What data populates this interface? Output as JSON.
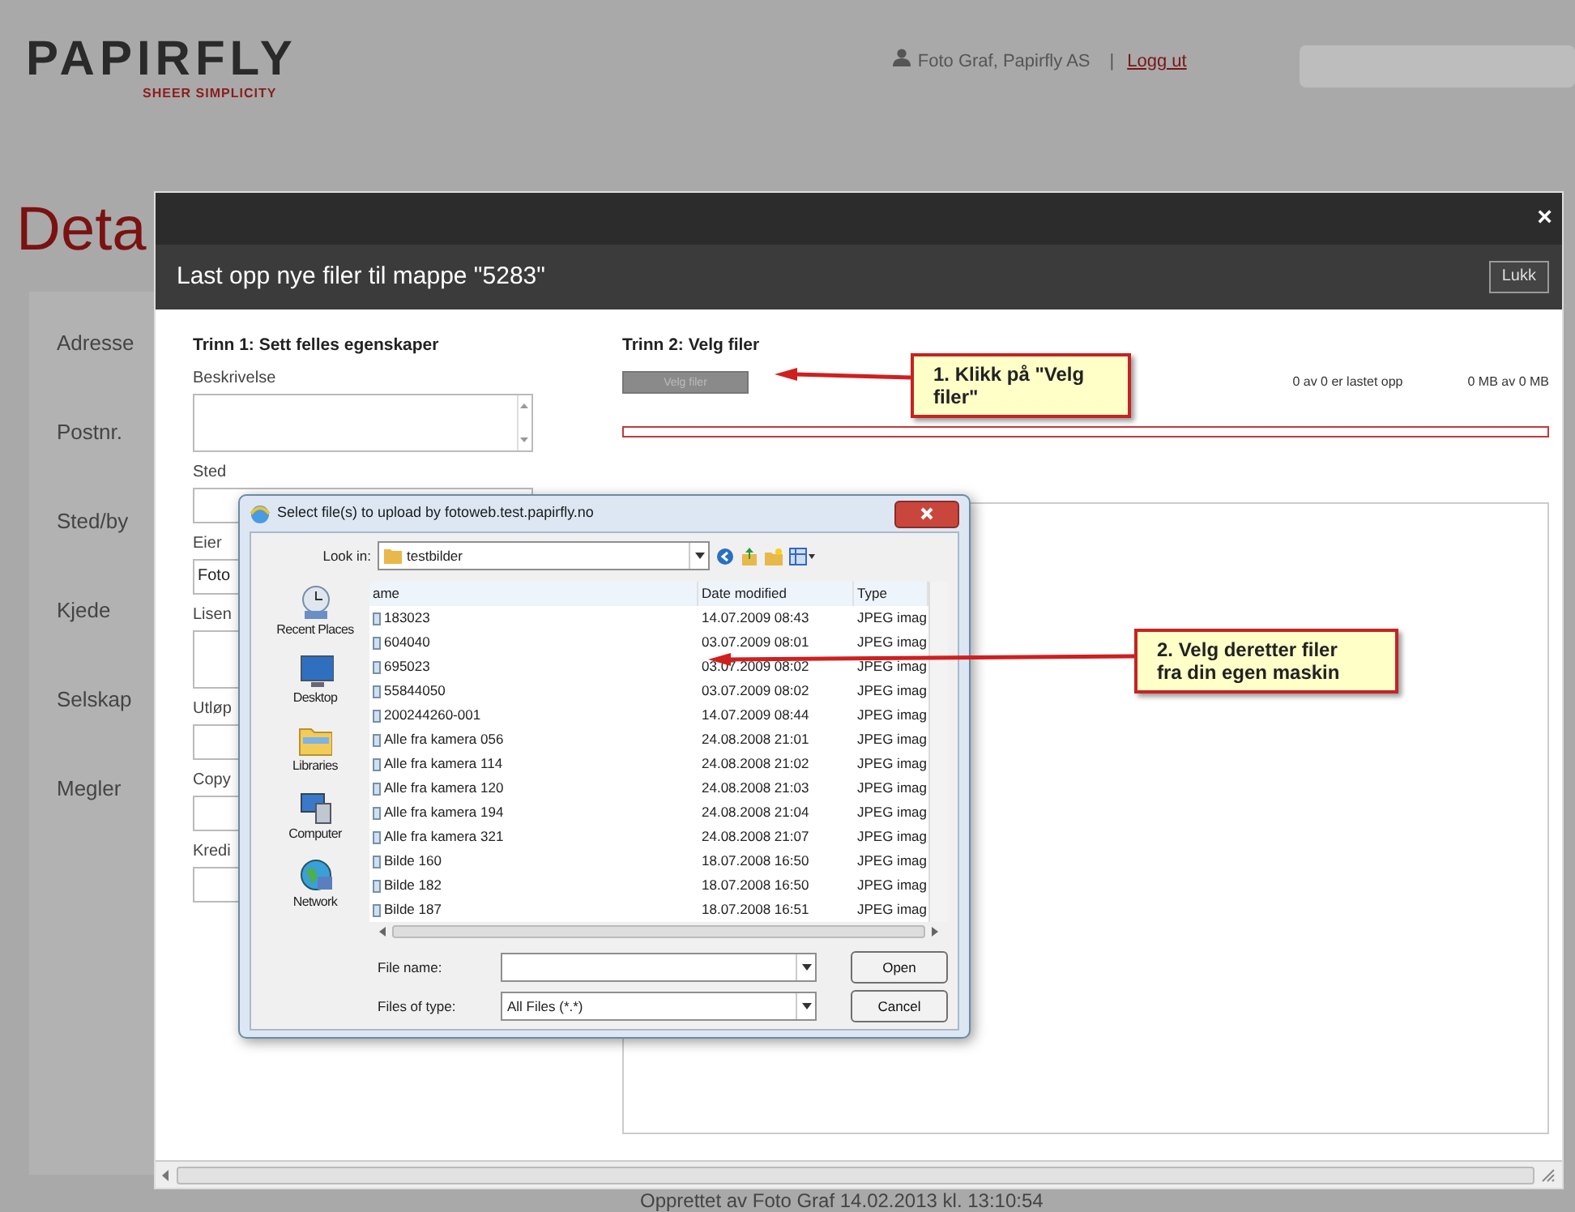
{
  "header": {
    "logo": "PAPIRFLY",
    "tagline": "SHEER SIMPLICITY",
    "user": "Foto Graf, Papirfly AS",
    "separator": "|",
    "logout": "Logg ut"
  },
  "page_title": "Deta",
  "form_labels": [
    "Adresse",
    "Postnr.",
    "Sted/by",
    "Kjede",
    "Selskap",
    "Megler"
  ],
  "modal": {
    "close": "×",
    "title": "Last opp nye filer til mappe \"5283\"",
    "close_button": "Lukk",
    "step1": {
      "heading": "Trinn 1: Sett felles egenskaper",
      "fields": [
        {
          "label": "Beskrivelse",
          "kind": "textarea"
        },
        {
          "label": "Sted",
          "kind": "input"
        },
        {
          "label": "Eier",
          "kind": "input",
          "value": "Foto"
        },
        {
          "label": "Lisen",
          "kind": "textarea"
        },
        {
          "label": "Utløp",
          "kind": "input"
        },
        {
          "label": "Copy",
          "kind": "input"
        },
        {
          "label": "Kredi",
          "kind": "input"
        }
      ]
    },
    "step2": {
      "heading": "Trinn 2: Velg filer",
      "select_button": {
        "label": "Velg filer",
        "disabled": true
      },
      "files_status": "0 av 0 er lastet opp",
      "size_status": "0 MB av 0 MB",
      "progress": {
        "level": 0
      }
    }
  },
  "callouts": [
    {
      "text": "1. Klikk på \"Velg filer\""
    },
    {
      "text": "2. Velg deretter filer fra din egen maskin"
    }
  ],
  "file_dialog": {
    "title": "Select file(s) to upload by fotoweb.test.papirfly.no",
    "look_in_label": "Look in:",
    "look_in": "testbilder",
    "places": [
      "Recent Places",
      "Desktop",
      "Libraries",
      "Computer",
      "Network"
    ],
    "columns": [
      "ame",
      "Date modified",
      "Type"
    ],
    "rows": [
      {
        "name": "183023",
        "date": "14.07.2009 08:43",
        "type": "JPEG imag"
      },
      {
        "name": "604040",
        "date": "03.07.2009 08:01",
        "type": "JPEG imag"
      },
      {
        "name": "695023",
        "date": "03.07.2009 08:02",
        "type": "JPEG imag"
      },
      {
        "name": "55844050",
        "date": "03.07.2009 08:02",
        "type": "JPEG imag"
      },
      {
        "name": "200244260-001",
        "date": "14.07.2009 08:44",
        "type": "JPEG imag"
      },
      {
        "name": "Alle fra kamera 056",
        "date": "24.08.2008 21:01",
        "type": "JPEG imag"
      },
      {
        "name": "Alle fra kamera 114",
        "date": "24.08.2008 21:02",
        "type": "JPEG imag"
      },
      {
        "name": "Alle fra kamera 120",
        "date": "24.08.2008 21:03",
        "type": "JPEG imag"
      },
      {
        "name": "Alle fra kamera 194",
        "date": "24.08.2008 21:04",
        "type": "JPEG imag"
      },
      {
        "name": "Alle fra kamera 321",
        "date": "24.08.2008 21:07",
        "type": "JPEG imag"
      },
      {
        "name": "Bilde 160",
        "date": "18.07.2008 16:50",
        "type": "JPEG imag"
      },
      {
        "name": "Bilde 182",
        "date": "18.07.2008 16:50",
        "type": "JPEG imag"
      },
      {
        "name": "Bilde 187",
        "date": "18.07.2008 16:51",
        "type": "JPEG imag"
      }
    ],
    "file_name_label": "File name:",
    "file_type_label": "Files of type:",
    "file_type": "All Files (*.*)",
    "buttons": [
      "Open",
      "Cancel"
    ]
  },
  "footer": "Opprettet av Foto Graf 14.02.2013 kl. 13:10:54"
}
